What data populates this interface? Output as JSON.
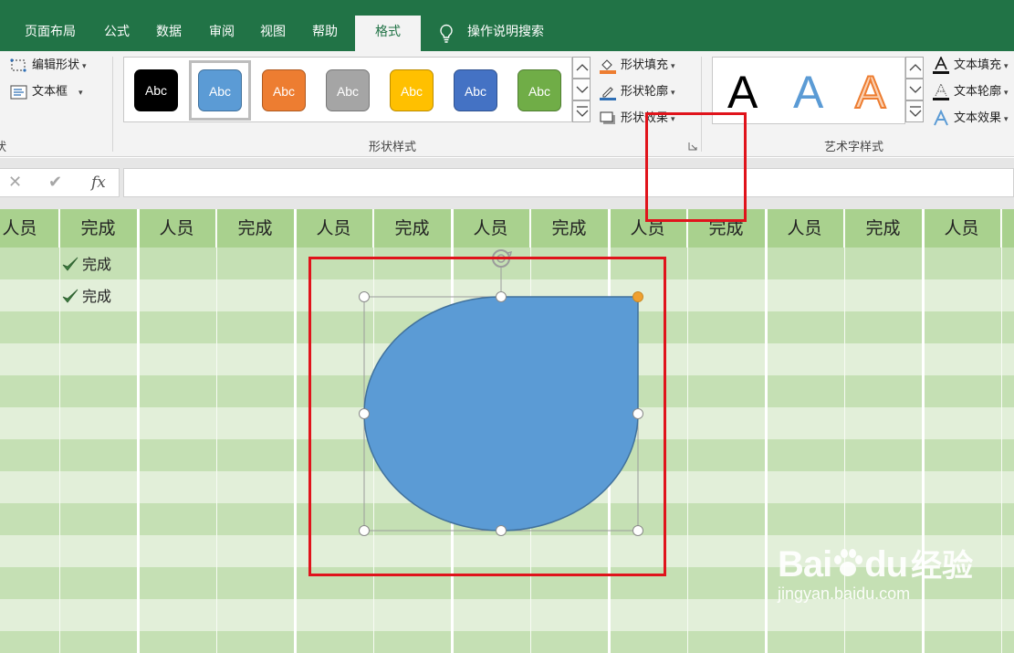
{
  "tabs": [
    {
      "label": "页面布局",
      "active": false
    },
    {
      "label": "公式",
      "active": false
    },
    {
      "label": "数据",
      "active": false
    },
    {
      "label": "审阅",
      "active": false
    },
    {
      "label": "视图",
      "active": false
    },
    {
      "label": "帮助",
      "active": false
    },
    {
      "label": "格式",
      "active": true
    }
  ],
  "tell_me": {
    "label": "操作说明搜索",
    "icon": "lightbulb-icon"
  },
  "insert_shapes": {
    "edit_shape": "编辑形状",
    "text_box": "文本框",
    "group_label_fragment": "状"
  },
  "shape_styles": {
    "group_label": "形状样式",
    "swatch_text": "Abc",
    "swatches": [
      {
        "color": "#000000",
        "selected": false
      },
      {
        "color": "#5b9bd5",
        "selected": true
      },
      {
        "color": "#ed7d31",
        "selected": false
      },
      {
        "color": "#a5a5a5",
        "selected": false
      },
      {
        "color": "#ffc000",
        "selected": false
      },
      {
        "color": "#4472c4",
        "selected": false
      },
      {
        "color": "#70ad47",
        "selected": false
      }
    ],
    "fill": "形状填充",
    "outline": "形状轮廓",
    "effects": "形状效果"
  },
  "wordart_styles": {
    "group_label": "艺术字样式",
    "letter": "A",
    "text_fill": "文本填充",
    "text_outline": "文本轮廓",
    "text_effects": "文本效果"
  },
  "formula_bar": {
    "cancel": "✕",
    "enter": "✔",
    "fx": "fx",
    "value": ""
  },
  "sheet": {
    "headers": [
      "人员",
      "完成",
      "人员",
      "完成",
      "人员",
      "完成",
      "人员",
      "完成",
      "人员",
      "完成",
      "人员",
      "完成",
      "人员"
    ],
    "done_cells": [
      "完成",
      "完成"
    ]
  },
  "colors": {
    "ribbon_green": "#217346",
    "header_green": "#a9d18e",
    "shape_fill": "#5b9bd5",
    "shape_stroke": "#41719c",
    "highlight_red": "#e0131b"
  },
  "watermark": {
    "brand": "Bai",
    "brand_tail": "du",
    "cn": "经验",
    "url": "jingyan.baidu.com"
  }
}
